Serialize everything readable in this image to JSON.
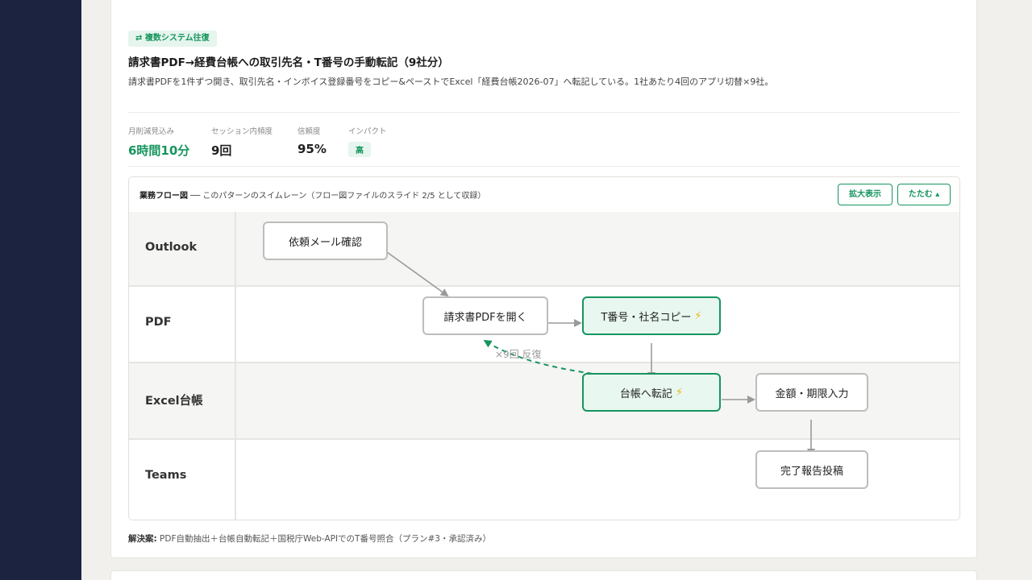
{
  "pattern": {
    "tag_icon": "⇄",
    "tag_label": "複数システム往復",
    "title": "請求書PDF→経費台帳への取引先名・T番号の手動転記（9社分）",
    "description": "請求書PDFを1件ずつ開き、取引先名・インボイス登録番号をコピー&ペーストでExcel「経費台帳2026-07」へ転記している。1社あたり4回のアプリ切替×9社。"
  },
  "metrics": [
    {
      "label": "月削減見込み",
      "value": "6時間10分"
    },
    {
      "label": "セッション内頻度",
      "value": "9回"
    },
    {
      "label": "信頼度",
      "value": "95%"
    },
    {
      "label": "インパクト",
      "value": "高"
    }
  ],
  "flow": {
    "title_bold": "業務フロー図",
    "title_rest": " ── このパターンのスイムレーン（フロー図ファイルのスライド 2/5 として収録）",
    "expand_button": "拡大表示",
    "collapse_button": "たたむ ▴",
    "lanes": [
      "Outlook",
      "PDF",
      "Excel台帳",
      "Teams"
    ],
    "nodes": {
      "n1": "依頼メール確認",
      "n2": "請求書PDFを開く",
      "n3": "T番号・社名コピー",
      "n4": "台帳へ転記",
      "n5": "金額・期限入力",
      "n6": "完了報告投稿"
    },
    "bolt": "⚡",
    "loop_label": "×9回 反復"
  },
  "solution": {
    "label": "解決案:",
    "text": " PDF自動抽出＋台帳自動転記＋国税庁Web-APIでのT番号照合（プラン#3・承認済み）"
  },
  "colors": {
    "accent": "#16955e",
    "sidebar": "#1c2340",
    "highlight_bg": "#e8f7f0",
    "bolt": "#f2b10a"
  }
}
